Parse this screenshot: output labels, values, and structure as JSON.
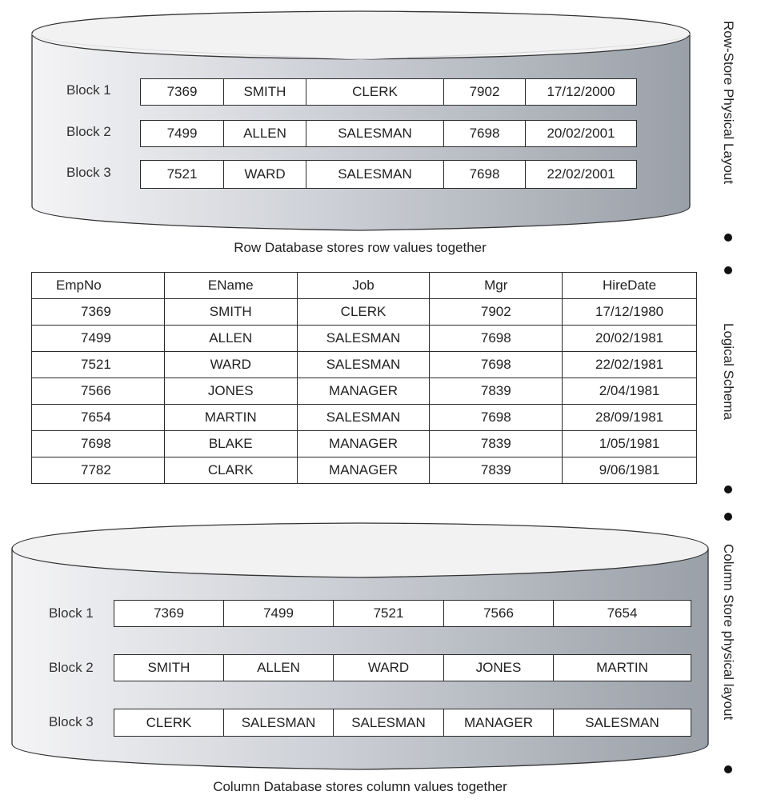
{
  "row_store": {
    "side_label": "Row-Store Physical Layout",
    "caption": "Row Database stores row values together",
    "blocks": [
      {
        "label": "Block 1",
        "cells": [
          "7369",
          "SMITH",
          "CLERK",
          "7902",
          "17/12/2000"
        ]
      },
      {
        "label": "Block 2",
        "cells": [
          "7499",
          "ALLEN",
          "SALESMAN",
          "7698",
          "20/02/2001"
        ]
      },
      {
        "label": "Block 3",
        "cells": [
          "7521",
          "WARD",
          "SALESMAN",
          "7698",
          "22/02/2001"
        ]
      }
    ]
  },
  "logical_schema": {
    "side_label": "Logical Schema",
    "headers": [
      "EmpNo",
      "EName",
      "Job",
      "Mgr",
      "HireDate"
    ],
    "rows": [
      [
        "7369",
        "SMITH",
        "CLERK",
        "7902",
        "17/12/1980"
      ],
      [
        "7499",
        "ALLEN",
        "SALESMAN",
        "7698",
        "20/02/1981"
      ],
      [
        "7521",
        "WARD",
        "SALESMAN",
        "7698",
        "22/02/1981"
      ],
      [
        "7566",
        "JONES",
        "MANAGER",
        "7839",
        "2/04/1981"
      ],
      [
        "7654",
        "MARTIN",
        "SALESMAN",
        "7698",
        "28/09/1981"
      ],
      [
        "7698",
        "BLAKE",
        "MANAGER",
        "7839",
        "1/05/1981"
      ],
      [
        "7782",
        "CLARK",
        "MANAGER",
        "7839",
        "9/06/1981"
      ]
    ]
  },
  "column_store": {
    "side_label": "Column Store physical layout",
    "caption": "Column Database stores column values together",
    "blocks": [
      {
        "label": "Block 1",
        "cells": [
          "7369",
          "7499",
          "7521",
          "7566",
          "7654"
        ]
      },
      {
        "label": "Block 2",
        "cells": [
          "SMITH",
          "ALLEN",
          "WARD",
          "JONES",
          "MARTIN"
        ]
      },
      {
        "label": "Block 3",
        "cells": [
          "CLERK",
          "SALESMAN",
          "SALESMAN",
          "MANAGER",
          "SALESMAN"
        ]
      }
    ]
  },
  "colors": {
    "cylinder_light": "#f3f3f5",
    "cylinder_dark": "#9ea3ab",
    "border": "#2a2a2a"
  }
}
